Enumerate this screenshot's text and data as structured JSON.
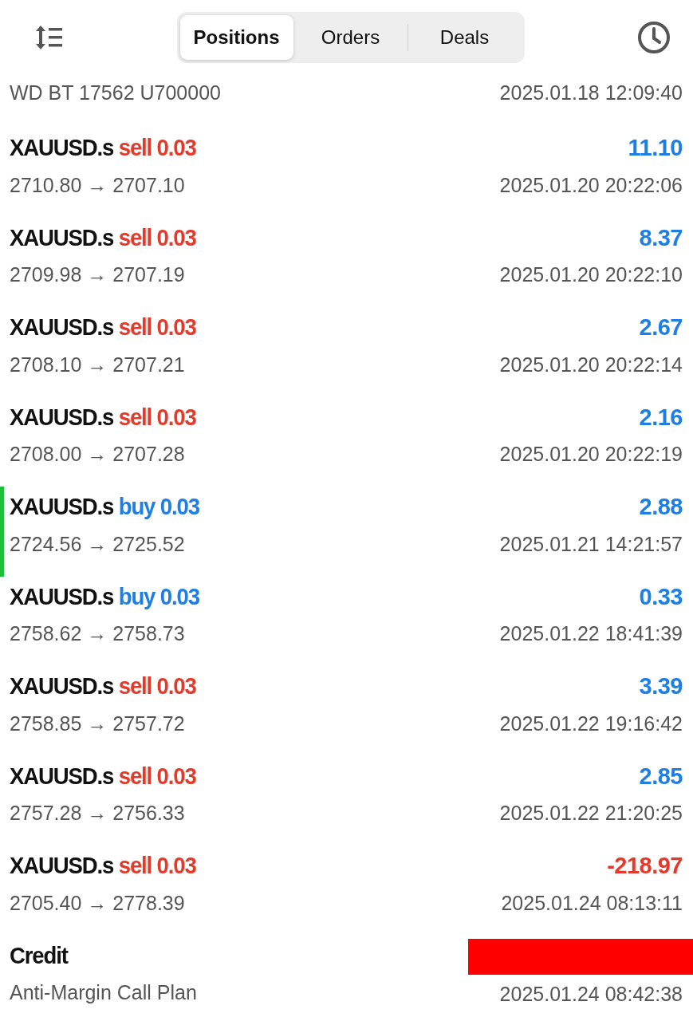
{
  "toolbar": {
    "tabs": [
      {
        "label": "Positions",
        "selected": true
      },
      {
        "label": "Orders",
        "selected": false
      },
      {
        "label": "Deals",
        "selected": false
      }
    ]
  },
  "account": {
    "label": "WD BT 17562 U700000",
    "time": "2025.01.18 12:09:40"
  },
  "deals": [
    {
      "kind": "trade",
      "symbol": "XAUUSD.s",
      "side": "sell",
      "volume": "0.03",
      "prices": "2710.80 → 2707.10",
      "profit": "11.10",
      "loss": false,
      "selected": false,
      "time": "2025.01.20 20:22:06"
    },
    {
      "kind": "trade",
      "symbol": "XAUUSD.s",
      "side": "sell",
      "volume": "0.03",
      "prices": "2709.98 → 2707.19",
      "profit": "8.37",
      "loss": false,
      "selected": false,
      "time": "2025.01.20 20:22:10"
    },
    {
      "kind": "trade",
      "symbol": "XAUUSD.s",
      "side": "sell",
      "volume": "0.03",
      "prices": "2708.10 → 2707.21",
      "profit": "2.67",
      "loss": false,
      "selected": false,
      "time": "2025.01.20 20:22:14"
    },
    {
      "kind": "trade",
      "symbol": "XAUUSD.s",
      "side": "sell",
      "volume": "0.03",
      "prices": "2708.00 → 2707.28",
      "profit": "2.16",
      "loss": false,
      "selected": false,
      "time": "2025.01.20 20:22:19"
    },
    {
      "kind": "trade",
      "symbol": "XAUUSD.s",
      "side": "buy",
      "volume": "0.03",
      "prices": "2724.56 → 2725.52",
      "profit": "2.88",
      "loss": false,
      "selected": true,
      "time": "2025.01.21 14:21:57"
    },
    {
      "kind": "trade",
      "symbol": "XAUUSD.s",
      "side": "buy",
      "volume": "0.03",
      "prices": "2758.62 → 2758.73",
      "profit": "0.33",
      "loss": false,
      "selected": false,
      "time": "2025.01.22 18:41:39"
    },
    {
      "kind": "trade",
      "symbol": "XAUUSD.s",
      "side": "sell",
      "volume": "0.03",
      "prices": "2758.85 → 2757.72",
      "profit": "3.39",
      "loss": false,
      "selected": false,
      "time": "2025.01.22 19:16:42"
    },
    {
      "kind": "trade",
      "symbol": "XAUUSD.s",
      "side": "sell",
      "volume": "0.03",
      "prices": "2757.28 → 2756.33",
      "profit": "2.85",
      "loss": false,
      "selected": false,
      "time": "2025.01.22 21:20:25"
    },
    {
      "kind": "trade",
      "symbol": "XAUUSD.s",
      "side": "sell",
      "volume": "0.03",
      "prices": "2705.40 → 2778.39",
      "profit": "-218.97",
      "loss": true,
      "selected": false,
      "time": "2025.01.24 08:13:11"
    },
    {
      "kind": "credit",
      "symbol": "Credit",
      "prices": "Anti-Margin Call Plan",
      "redacted": true,
      "selected": false,
      "time": "2025.01.24 08:42:38"
    }
  ]
}
